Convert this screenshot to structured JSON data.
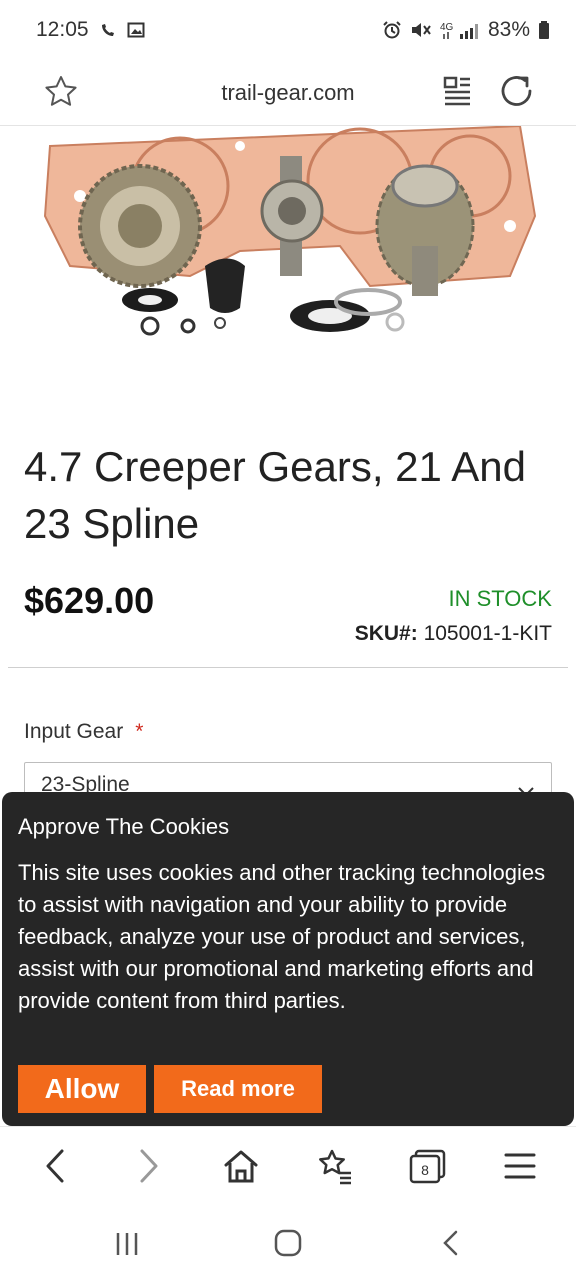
{
  "status_bar": {
    "time": "12:05",
    "battery": "83%"
  },
  "browser": {
    "url": "trail-gear.com",
    "tab_count": "8"
  },
  "product": {
    "title": "4.7 Creeper Gears, 21 And 23 Spline",
    "price": "$629.00",
    "stock_status": "IN STOCK",
    "sku_label": "SKU#:",
    "sku_value": "105001-1-KIT",
    "image_icon": "gear-kit-product-image"
  },
  "options": {
    "input_gear_label": "Input Gear",
    "required_marker": "*",
    "input_gear_value": "23-Spline"
  },
  "cookie_banner": {
    "title": "Approve The Cookies",
    "text": "This site uses cookies and other tracking technologies to assist with navigation and your ability to provide feedback, analyze your use of product and services, assist with our promotional and marketing efforts and provide content from third parties.",
    "allow_label": "Allow",
    "read_more_label": "Read more"
  },
  "colors": {
    "accent": "#f26a1b",
    "in_stock": "#1f8f2a",
    "banner_bg": "#262626",
    "required": "#d02a1f"
  }
}
